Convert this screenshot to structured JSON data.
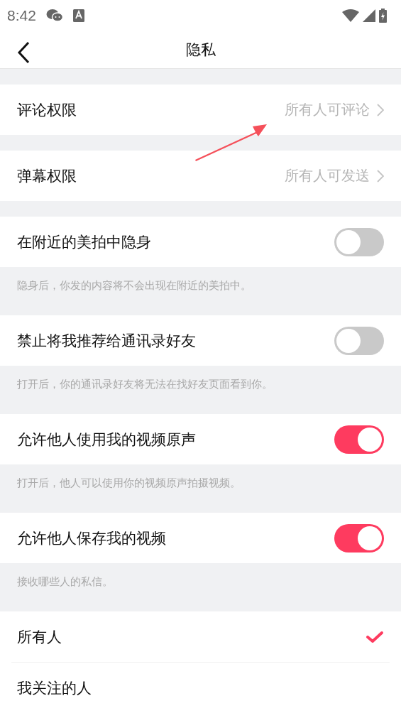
{
  "status_bar": {
    "time": "8:42"
  },
  "header": {
    "title": "隐私"
  },
  "sections": [
    {
      "kind": "link",
      "label": "评论权限",
      "value": "所有人可评论"
    },
    {
      "kind": "link",
      "label": "弹幕权限",
      "value": "所有人可发送"
    },
    {
      "kind": "toggle",
      "label": "在附近的美拍中隐身",
      "on": false,
      "note": "隐身后，你发的内容将不会出现在附近的美拍中。"
    },
    {
      "kind": "toggle",
      "label": "禁止将我推荐给通讯录好友",
      "on": false,
      "note": "打开后，你的通讯录好友将无法在找好友页面看到你。"
    },
    {
      "kind": "toggle",
      "label": "允许他人使用我的视频原声",
      "on": true,
      "note": "打开后，他人可以使用你的视频原声拍摄视频。"
    },
    {
      "kind": "toggle",
      "label": "允许他人保存我的视频",
      "on": true
    }
  ],
  "messages": {
    "note": "接收哪些人的私信。",
    "options": [
      {
        "label": "所有人",
        "selected": true
      },
      {
        "label": "我关注的人",
        "selected": false
      }
    ]
  }
}
